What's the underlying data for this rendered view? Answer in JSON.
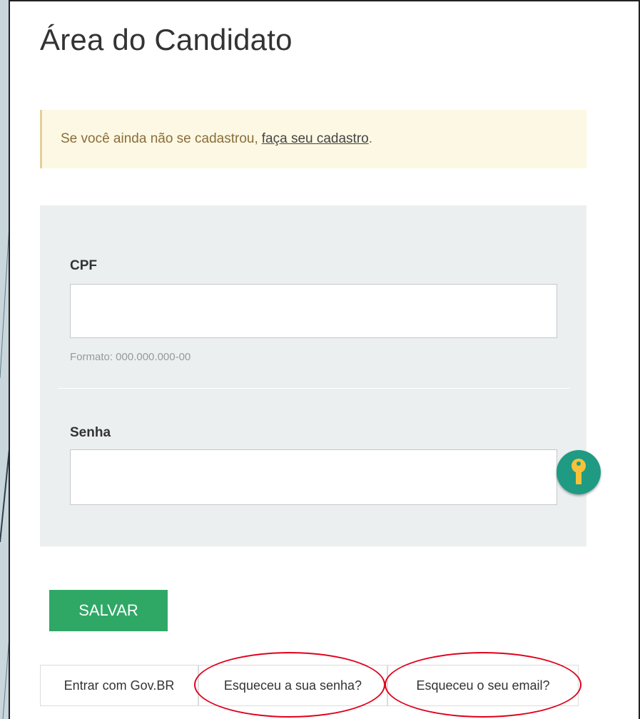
{
  "header": {
    "title": "Área do Candidato"
  },
  "alert": {
    "text": "Se você ainda não se cadastrou,",
    "link": "faça seu cadastro",
    "suffix": "."
  },
  "form": {
    "cpf_label": "CPF",
    "cpf_value": "",
    "cpf_help": "Formato: 000.000.000-00",
    "password_label": "Senha",
    "password_value": "",
    "key_icon": "key-icon"
  },
  "actions": {
    "save_label": "SALVAR"
  },
  "links": {
    "govbr": "Entrar com Gov.BR",
    "forgot_password": "Esqueceu a sua senha?",
    "forgot_email": "Esqueceu o seu email?"
  },
  "colors": {
    "save_button": "#2fa866",
    "key_button": "#1f9a83",
    "alert_bg": "#fcf8e3",
    "highlight_ellipse": "#e0001b"
  }
}
